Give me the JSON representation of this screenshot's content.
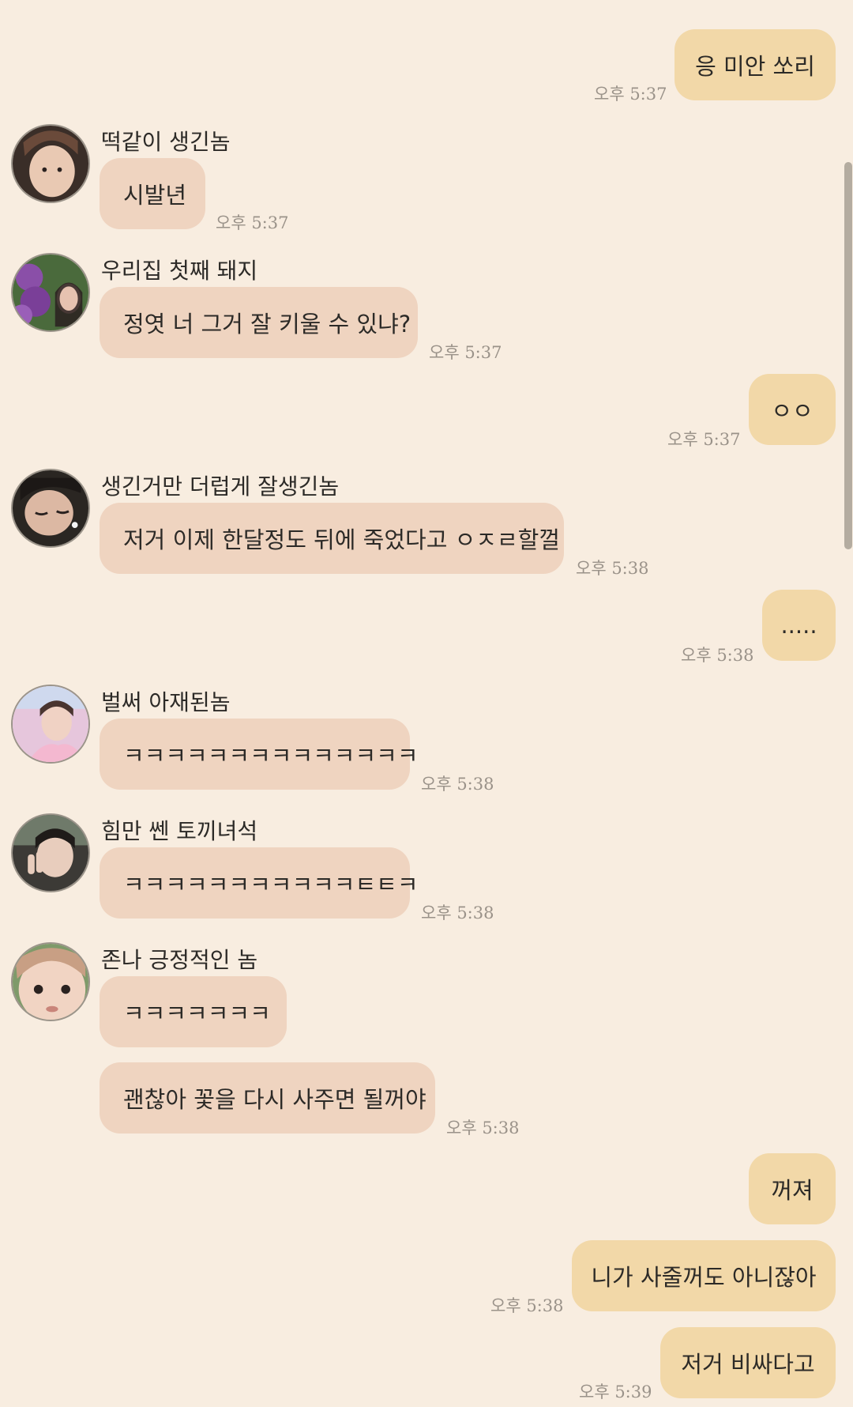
{
  "messages": [
    {
      "side": "out",
      "text": "응 미안 쏘리",
      "time": "오후 5:37"
    },
    {
      "side": "in",
      "sender": "떡같이 생긴놈",
      "text": "시발년",
      "time": "오후 5:37"
    },
    {
      "side": "in",
      "sender": "우리집 첫째 돼지",
      "text": "정엿 너 그거 잘 키울 수 있냐?",
      "time": "오후 5:37"
    },
    {
      "side": "out",
      "text": "ㅇㅇ",
      "time": "오후 5:37"
    },
    {
      "side": "in",
      "sender": "생긴거만 더럽게 잘생긴놈",
      "text": "저거 이제 한달정도 뒤에 죽었다고 ㅇㅈㄹ할껄",
      "time": "오후 5:38"
    },
    {
      "side": "out",
      "text": ".....",
      "time": "오후 5:38"
    },
    {
      "side": "in",
      "sender": "벌써 아재된놈",
      "text": "ㅋㅋㅋㅋㅋㅋㅋㅋㅋㅋㅋㅋㅋㅋ",
      "time": "오후 5:38"
    },
    {
      "side": "in",
      "sender": "힘만 쎈 토끼녀석",
      "text": "ㅋㅋㅋㅋㅋㅋㅋㅋㅋㅋㅋㅌㅌㅋ",
      "time": "오후 5:38"
    },
    {
      "side": "in",
      "sender": "존나 긍정적인 놈",
      "text": "ㅋㅋㅋㅋㅋㅋㅋ"
    },
    {
      "side": "in",
      "text": "괜찮아 꽃을 다시 사주면 될꺼야",
      "time": "오후 5:38"
    },
    {
      "side": "out",
      "text": "꺼져"
    },
    {
      "side": "out",
      "text": "니가 사줄꺼도 아니잖아",
      "time": "오후 5:38"
    },
    {
      "side": "out",
      "text": "저거 비싸다고",
      "time": "오후 5:39"
    }
  ],
  "avatars": [
    {
      "name": "avatar-face-icon",
      "bg": "#3a2e28",
      "face": "#e9c9b3"
    },
    {
      "name": "avatar-flowers-icon",
      "bg": "#5b3e6e",
      "face": "#e6c2b0"
    },
    {
      "name": "avatar-sleeping-icon",
      "bg": "#2a2622",
      "face": "#dcb8a3"
    },
    {
      "name": "avatar-pink-icon",
      "bg": "#e6c6dc",
      "face": "#f0d2c4"
    },
    {
      "name": "avatar-peace-icon",
      "bg": "#3c3a36",
      "face": "#e8cdbd"
    },
    {
      "name": "avatar-closeup-icon",
      "bg": "#c89f84",
      "face": "#f1d4c3"
    }
  ],
  "colors": {
    "background": "#f8ede0",
    "incoming_bubble": "#efd4c0",
    "outgoing_bubble": "#f2d8a8",
    "timestamp": "#9a9289"
  }
}
